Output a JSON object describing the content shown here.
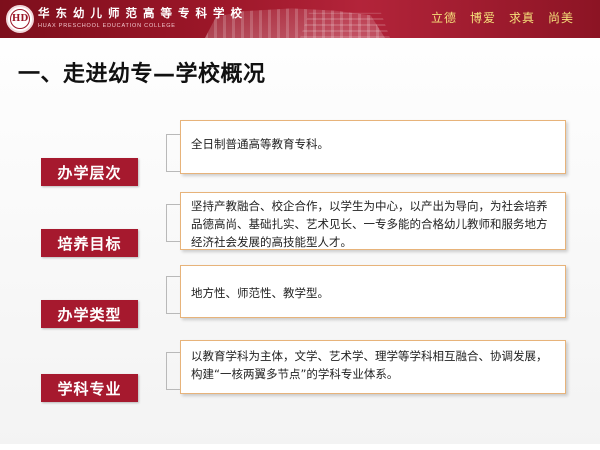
{
  "header": {
    "school_name": "华 东 幼 儿 师 范 高 等 专 科 学 校",
    "school_name_en": "HUAX PRESCHOOL EDUCATION COLLEGE",
    "logo_text": "HD",
    "motto": [
      "立德",
      "博爱",
      "求真",
      "尚美"
    ],
    "colors": {
      "brand": "#9b1628",
      "motto": "#f6e07a"
    }
  },
  "page_title": "一、走进幼专—学校概况",
  "sections": [
    {
      "label": "办学层次",
      "content": "全日制普通高等教育专科。"
    },
    {
      "label": "培养目标",
      "content": "坚持产教融合、校企合作，以学生为中心，以产出为导向，为社会培养品德高尚、基础扎实、艺术见长、一专多能的合格幼儿教师和服务地方经济社会发展的高技能型人才。"
    },
    {
      "label": "办学类型",
      "content": "地方性、师范性、教学型。"
    },
    {
      "label": "学科专业",
      "content": "以教育学科为主体，文学、艺术学、理学等学科相互融合、协调发展，构建“一核两翼多节点”的学科专业体系。"
    }
  ],
  "colors": {
    "label_bg": "#a6192e",
    "box_border": "#e7b37a"
  }
}
